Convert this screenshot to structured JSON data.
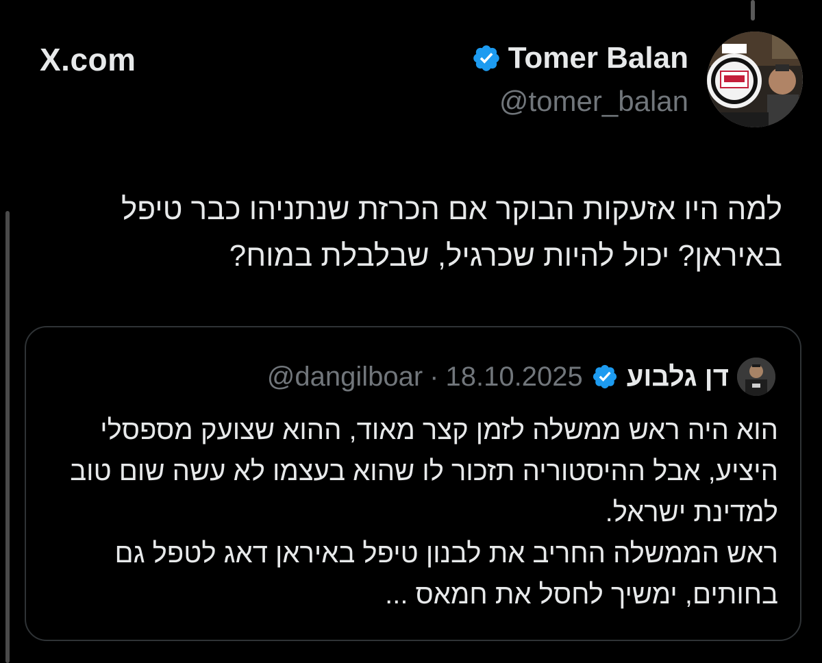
{
  "site": {
    "label": "X.com"
  },
  "tweet": {
    "author": {
      "name": "Tomer Balan",
      "handle": "@tomer_balan",
      "verified_badge_icon": "verified-badge-icon",
      "avatar_icon": "avatar-photo"
    },
    "text": "למה היו אזעקות הבוקר אם הכרזת שנתניהו כבר טיפל באיראן? יכול להיות שכרגיל, שבלבלת במוח?"
  },
  "quote": {
    "author": {
      "name": "דן גלבוע",
      "handle": "@dangilboar",
      "separator": "·",
      "date": "18.10.2025",
      "verified_badge_icon": "verified-badge-icon",
      "avatar_icon": "avatar-photo"
    },
    "paragraphs": [
      "הוא היה ראש ממשלה לזמן קצר מאוד, ההוא שצועק מספסלי היציע, אבל ההיסטוריה תזכור לו שהוא בעצמו לא עשה שום טוב למדינת ישראל.",
      "ראש הממשלה החריב את לבנון טיפל באיראן דאג לטפל גם בחותים, ימשיך לחסל את חמאס ..."
    ]
  },
  "colors": {
    "background": "#000000",
    "text_primary": "#e7e9ea",
    "text_secondary": "#71767b",
    "badge_blue": "#1d9bf0",
    "card_border": "#2f3336"
  }
}
